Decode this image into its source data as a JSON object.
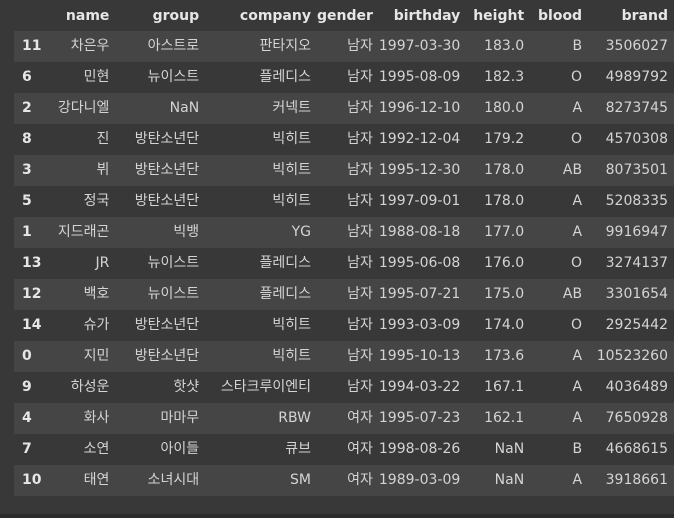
{
  "table": {
    "columns": [
      "name",
      "group",
      "company",
      "gender",
      "birthday",
      "height",
      "blood",
      "brand"
    ],
    "rows": [
      {
        "index": "11",
        "cells": [
          "차은우",
          "아스트로",
          "판타지오",
          "남자",
          "1997-03-30",
          "183.0",
          "B",
          "3506027"
        ]
      },
      {
        "index": "6",
        "cells": [
          "민현",
          "뉴이스트",
          "플레디스",
          "남자",
          "1995-08-09",
          "182.3",
          "O",
          "4989792"
        ]
      },
      {
        "index": "2",
        "cells": [
          "강다니엘",
          "NaN",
          "커넥트",
          "남자",
          "1996-12-10",
          "180.0",
          "A",
          "8273745"
        ]
      },
      {
        "index": "8",
        "cells": [
          "진",
          "방탄소년단",
          "빅히트",
          "남자",
          "1992-12-04",
          "179.2",
          "O",
          "4570308"
        ]
      },
      {
        "index": "3",
        "cells": [
          "뷔",
          "방탄소년단",
          "빅히트",
          "남자",
          "1995-12-30",
          "178.0",
          "AB",
          "8073501"
        ]
      },
      {
        "index": "5",
        "cells": [
          "정국",
          "방탄소년단",
          "빅히트",
          "남자",
          "1997-09-01",
          "178.0",
          "A",
          "5208335"
        ]
      },
      {
        "index": "1",
        "cells": [
          "지드래곤",
          "빅뱅",
          "YG",
          "남자",
          "1988-08-18",
          "177.0",
          "A",
          "9916947"
        ]
      },
      {
        "index": "13",
        "cells": [
          "JR",
          "뉴이스트",
          "플레디스",
          "남자",
          "1995-06-08",
          "176.0",
          "O",
          "3274137"
        ]
      },
      {
        "index": "12",
        "cells": [
          "백호",
          "뉴이스트",
          "플레디스",
          "남자",
          "1995-07-21",
          "175.0",
          "AB",
          "3301654"
        ]
      },
      {
        "index": "14",
        "cells": [
          "슈가",
          "방탄소년단",
          "빅히트",
          "남자",
          "1993-03-09",
          "174.0",
          "O",
          "2925442"
        ]
      },
      {
        "index": "0",
        "cells": [
          "지민",
          "방탄소년단",
          "빅히트",
          "남자",
          "1995-10-13",
          "173.6",
          "A",
          "10523260"
        ]
      },
      {
        "index": "9",
        "cells": [
          "하성운",
          "핫샷",
          "스타크루이엔티",
          "남자",
          "1994-03-22",
          "167.1",
          "A",
          "4036489"
        ]
      },
      {
        "index": "4",
        "cells": [
          "화사",
          "마마무",
          "RBW",
          "여자",
          "1995-07-23",
          "162.1",
          "A",
          "7650928"
        ]
      },
      {
        "index": "7",
        "cells": [
          "소연",
          "아이들",
          "큐브",
          "여자",
          "1998-08-26",
          "NaN",
          "B",
          "4668615"
        ]
      },
      {
        "index": "10",
        "cells": [
          "태연",
          "소녀시대",
          "SM",
          "여자",
          "1989-03-09",
          "NaN",
          "A",
          "3918661"
        ]
      }
    ]
  }
}
